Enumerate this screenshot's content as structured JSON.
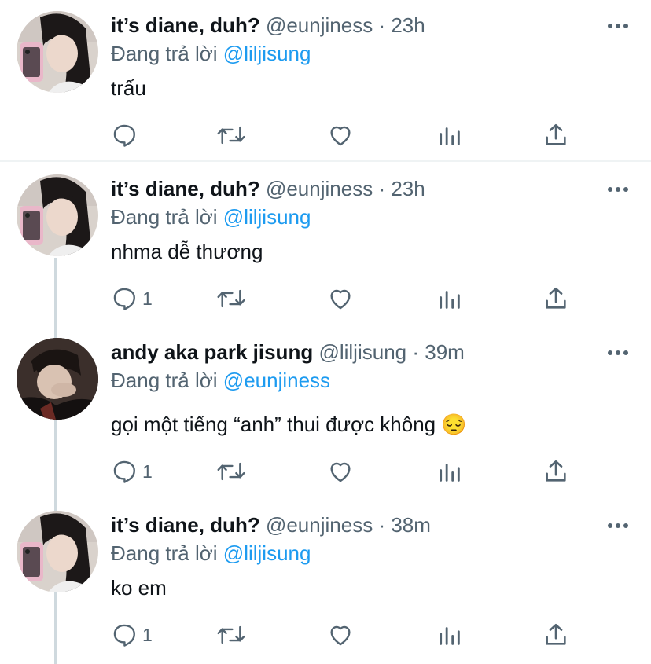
{
  "tweets": [
    {
      "name": "it’s diane, duh?",
      "handle": "@eunjiness",
      "sep": "·",
      "time": "23h",
      "reply_prefix": "Đang trả lời",
      "reply_to": "@liljisung",
      "text": "trẩu",
      "reply_count": "",
      "avatar": "diane-avatar"
    },
    {
      "name": "it’s diane, duh?",
      "handle": "@eunjiness",
      "sep": "·",
      "time": "23h",
      "reply_prefix": "Đang trả lời",
      "reply_to": "@liljisung",
      "text": "nhma dễ thương",
      "reply_count": "1",
      "avatar": "diane-avatar"
    },
    {
      "name": "andy aka park jisung",
      "handle": "@liljisung",
      "sep": "·",
      "time": "39m",
      "reply_prefix": "Đang trả lời",
      "reply_to": "@eunjiness",
      "text": "gọi một tiếng “anh” thui được không 😔",
      "reply_count": "1",
      "avatar": "andy-avatar"
    },
    {
      "name": "it’s diane, duh?",
      "handle": "@eunjiness",
      "sep": "·",
      "time": "38m",
      "reply_prefix": "Đang trả lời",
      "reply_to": "@liljisung",
      "text": "ko em",
      "reply_count": "1",
      "avatar": "diane-avatar"
    }
  ],
  "icons": [
    "more-icon",
    "reply-icon",
    "retweet-icon",
    "like-icon",
    "analytics-icon",
    "share-icon"
  ],
  "colors": {
    "link": "#1d9bf0",
    "secondary": "#536471",
    "text": "#0f1419",
    "thread_line": "#cfd9de",
    "divider": "#eff3f4"
  }
}
